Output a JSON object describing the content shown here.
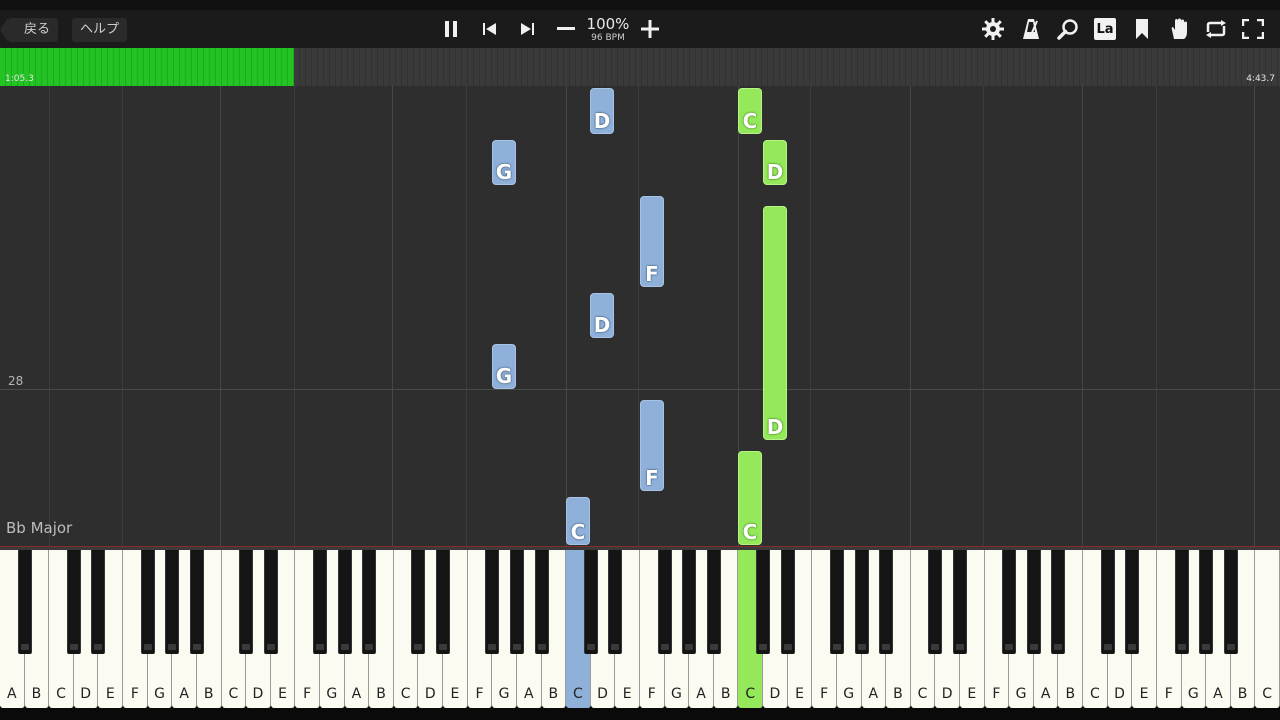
{
  "toolbar": {
    "back_label": "戻る",
    "help_label": "ヘルプ",
    "tempo_percent": "100%",
    "tempo_bpm": "96 BPM",
    "la_label": "La",
    "icons": [
      "pause-icon",
      "skip-back-icon",
      "skip-forward-icon",
      "minus-icon",
      "plus-icon",
      "gear-icon",
      "metronome-icon",
      "magnifier-icon",
      "label-toggle-icon",
      "bookmark-icon",
      "hand-icon",
      "loop-icon",
      "fullscreen-icon"
    ]
  },
  "progress": {
    "current_time": "1:05.3",
    "total_time": "4:43.7",
    "fraction": 0.23,
    "color": "#22c322"
  },
  "roll": {
    "measure_number": "28",
    "key_signature": "Bb Major",
    "notes": [
      {
        "label": "D",
        "hand": "right",
        "color": "blue"
      },
      {
        "label": "G",
        "hand": "right",
        "color": "blue"
      },
      {
        "label": "F",
        "hand": "right",
        "color": "blue"
      },
      {
        "label": "D",
        "hand": "right",
        "color": "blue"
      },
      {
        "label": "G",
        "hand": "right",
        "color": "blue"
      },
      {
        "label": "F",
        "hand": "right",
        "color": "blue"
      },
      {
        "label": "C",
        "hand": "right",
        "color": "blue"
      },
      {
        "label": "C",
        "hand": "left",
        "color": "green"
      },
      {
        "label": "D",
        "hand": "left",
        "color": "green"
      },
      {
        "label": "D",
        "hand": "left",
        "color": "green"
      },
      {
        "label": "C",
        "hand": "left",
        "color": "green"
      }
    ]
  },
  "keyboard": {
    "white_keys": [
      "A",
      "B",
      "C",
      "D",
      "E",
      "F",
      "G",
      "A",
      "B",
      "C",
      "D",
      "E",
      "F",
      "G",
      "A",
      "B",
      "C",
      "D",
      "E",
      "F",
      "G",
      "A",
      "B",
      "C",
      "D",
      "E",
      "F",
      "G",
      "A",
      "B",
      "C",
      "D",
      "E",
      "F",
      "G",
      "A",
      "B",
      "C",
      "D",
      "E",
      "F",
      "G",
      "A",
      "B",
      "C",
      "D",
      "E",
      "F",
      "G",
      "A",
      "B",
      "C"
    ],
    "pressed_blue_index": 23,
    "pressed_green_index": 30,
    "colors": {
      "right_hand": "#8fb1d9",
      "left_hand": "#94e85a"
    }
  }
}
